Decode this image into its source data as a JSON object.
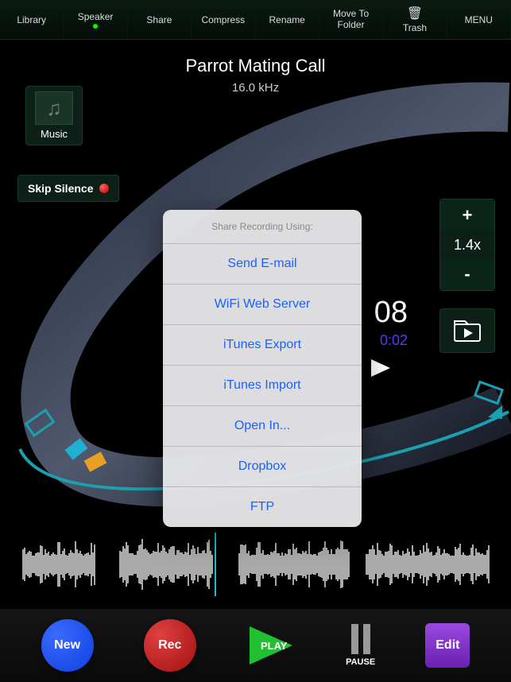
{
  "toolbar": {
    "library": "Library",
    "speaker": "Speaker",
    "share": "Share",
    "compress": "Compress",
    "rename": "Rename",
    "move_to_folder": "Move To\nFolder",
    "trash": "Trash",
    "menu": "MENU"
  },
  "title": "Parrot Mating Call",
  "subtitle": "16.0 kHz",
  "music_label": "Music",
  "skip_silence": "Skip Silence",
  "speed": {
    "plus": "+",
    "value": "1.4x",
    "minus": "-"
  },
  "time_fragment": "08",
  "time_sub": "0:02",
  "share_popup": {
    "header": "Share Recording Using:",
    "items": [
      "Send E-mail",
      "WiFi Web Server",
      "iTunes Export",
      "iTunes Import",
      "Open In...",
      "Dropbox",
      "FTP"
    ]
  },
  "bottom": {
    "new": "New",
    "rec": "Rec",
    "play": "PLAY",
    "pause": "PAUSE",
    "edit": "Edit"
  }
}
